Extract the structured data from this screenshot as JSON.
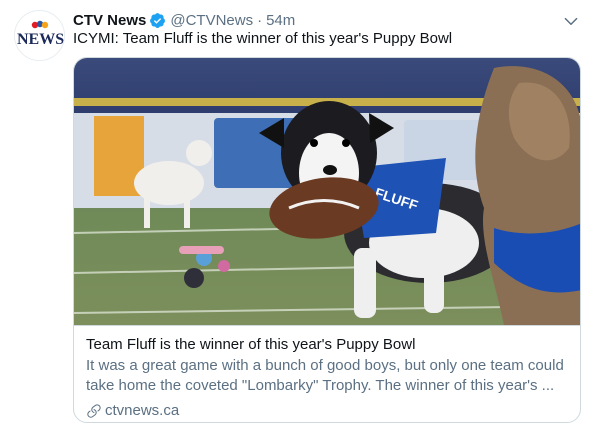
{
  "tweet": {
    "author_name": "CTV News",
    "handle": "@CTVNews",
    "separator": "·",
    "time": "54m",
    "text": "ICYMI: Team Fluff is the winner of this year's Puppy Bowl",
    "avatar_logo_text": "NEWS",
    "icons": {
      "verified": "verified-badge-icon",
      "more": "chevron-down-icon",
      "link": "link-icon"
    },
    "colors": {
      "verified": "#1da1f2",
      "secondary_text": "#5b7083",
      "border": "#cfd9de"
    }
  },
  "card": {
    "bandana_text": "FLUFF",
    "title": "Team Fluff is the winner of this year's Puppy Bowl",
    "description": "It was a great game with a bunch of good boys, but only one team could take home the coveted \"Lombarky\" Trophy. The winner of this year's ...",
    "domain": "ctvnews.ca"
  }
}
